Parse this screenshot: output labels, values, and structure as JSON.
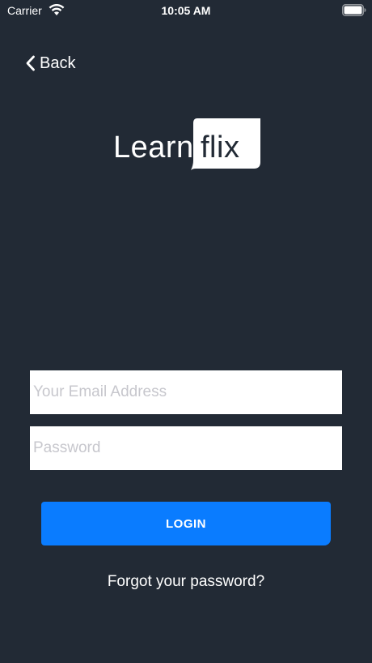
{
  "status_bar": {
    "carrier": "Carrier",
    "time": "10:05 AM",
    "wifi_icon": "wifi-icon",
    "battery_icon": "battery-icon"
  },
  "nav": {
    "back_label": "Back",
    "back_icon": "chevron-left-icon"
  },
  "logo": {
    "word": "Learn",
    "badge_word": "flix"
  },
  "form": {
    "email_placeholder": "Your Email Address",
    "email_value": "",
    "password_placeholder": "Password",
    "password_value": "",
    "login_label": "LOGIN",
    "forgot_label": "Forgot your password?"
  },
  "colors": {
    "background": "#222a35",
    "accent": "#0a7cff",
    "text": "#ffffff"
  }
}
